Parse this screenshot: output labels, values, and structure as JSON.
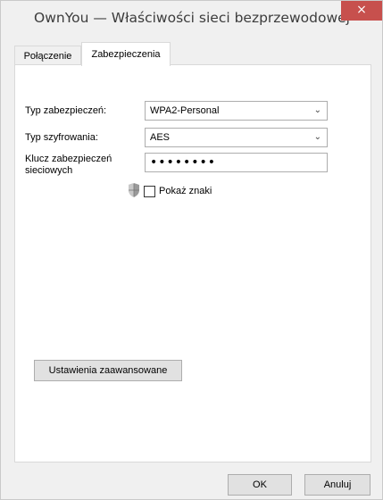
{
  "window": {
    "title": "OwnYou — Właściwości sieci bezprzewodowej",
    "close_label": "×"
  },
  "tabs": [
    {
      "label": "Połączenie",
      "active": false
    },
    {
      "label": "Zabezpieczenia",
      "active": true
    }
  ],
  "security": {
    "type_label": "Typ zabezpieczeń:",
    "type_value": "WPA2-Personal",
    "encryption_label": "Typ szyfrowania:",
    "encryption_value": "AES",
    "key_label": "Klucz zabezpieczeń sieciowych",
    "key_value": "••••••••",
    "show_chars_label": "Pokaż znaki",
    "show_chars_checked": false,
    "advanced_button": "Ustawienia zaawansowane"
  },
  "footer": {
    "ok_label": "OK",
    "cancel_label": "Anuluj"
  },
  "colors": {
    "close_button": "#c7504d",
    "panel_bg": "#ffffff",
    "window_bg": "#f0f0f0"
  }
}
